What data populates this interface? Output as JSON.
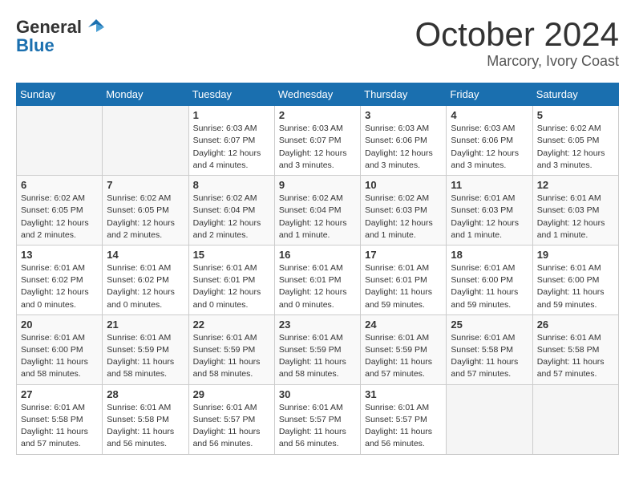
{
  "header": {
    "logo_general": "General",
    "logo_blue": "Blue",
    "month_title": "October 2024",
    "location": "Marcory, Ivory Coast"
  },
  "calendar": {
    "days_of_week": [
      "Sunday",
      "Monday",
      "Tuesday",
      "Wednesday",
      "Thursday",
      "Friday",
      "Saturday"
    ],
    "weeks": [
      [
        {
          "day": "",
          "info": ""
        },
        {
          "day": "",
          "info": ""
        },
        {
          "day": "1",
          "info": "Sunrise: 6:03 AM\nSunset: 6:07 PM\nDaylight: 12 hours and 4 minutes."
        },
        {
          "day": "2",
          "info": "Sunrise: 6:03 AM\nSunset: 6:07 PM\nDaylight: 12 hours and 3 minutes."
        },
        {
          "day": "3",
          "info": "Sunrise: 6:03 AM\nSunset: 6:06 PM\nDaylight: 12 hours and 3 minutes."
        },
        {
          "day": "4",
          "info": "Sunrise: 6:03 AM\nSunset: 6:06 PM\nDaylight: 12 hours and 3 minutes."
        },
        {
          "day": "5",
          "info": "Sunrise: 6:02 AM\nSunset: 6:05 PM\nDaylight: 12 hours and 3 minutes."
        }
      ],
      [
        {
          "day": "6",
          "info": "Sunrise: 6:02 AM\nSunset: 6:05 PM\nDaylight: 12 hours and 2 minutes."
        },
        {
          "day": "7",
          "info": "Sunrise: 6:02 AM\nSunset: 6:05 PM\nDaylight: 12 hours and 2 minutes."
        },
        {
          "day": "8",
          "info": "Sunrise: 6:02 AM\nSunset: 6:04 PM\nDaylight: 12 hours and 2 minutes."
        },
        {
          "day": "9",
          "info": "Sunrise: 6:02 AM\nSunset: 6:04 PM\nDaylight: 12 hours and 1 minute."
        },
        {
          "day": "10",
          "info": "Sunrise: 6:02 AM\nSunset: 6:03 PM\nDaylight: 12 hours and 1 minute."
        },
        {
          "day": "11",
          "info": "Sunrise: 6:01 AM\nSunset: 6:03 PM\nDaylight: 12 hours and 1 minute."
        },
        {
          "day": "12",
          "info": "Sunrise: 6:01 AM\nSunset: 6:03 PM\nDaylight: 12 hours and 1 minute."
        }
      ],
      [
        {
          "day": "13",
          "info": "Sunrise: 6:01 AM\nSunset: 6:02 PM\nDaylight: 12 hours and 0 minutes."
        },
        {
          "day": "14",
          "info": "Sunrise: 6:01 AM\nSunset: 6:02 PM\nDaylight: 12 hours and 0 minutes."
        },
        {
          "day": "15",
          "info": "Sunrise: 6:01 AM\nSunset: 6:01 PM\nDaylight: 12 hours and 0 minutes."
        },
        {
          "day": "16",
          "info": "Sunrise: 6:01 AM\nSunset: 6:01 PM\nDaylight: 12 hours and 0 minutes."
        },
        {
          "day": "17",
          "info": "Sunrise: 6:01 AM\nSunset: 6:01 PM\nDaylight: 11 hours and 59 minutes."
        },
        {
          "day": "18",
          "info": "Sunrise: 6:01 AM\nSunset: 6:00 PM\nDaylight: 11 hours and 59 minutes."
        },
        {
          "day": "19",
          "info": "Sunrise: 6:01 AM\nSunset: 6:00 PM\nDaylight: 11 hours and 59 minutes."
        }
      ],
      [
        {
          "day": "20",
          "info": "Sunrise: 6:01 AM\nSunset: 6:00 PM\nDaylight: 11 hours and 58 minutes."
        },
        {
          "day": "21",
          "info": "Sunrise: 6:01 AM\nSunset: 5:59 PM\nDaylight: 11 hours and 58 minutes."
        },
        {
          "day": "22",
          "info": "Sunrise: 6:01 AM\nSunset: 5:59 PM\nDaylight: 11 hours and 58 minutes."
        },
        {
          "day": "23",
          "info": "Sunrise: 6:01 AM\nSunset: 5:59 PM\nDaylight: 11 hours and 58 minutes."
        },
        {
          "day": "24",
          "info": "Sunrise: 6:01 AM\nSunset: 5:59 PM\nDaylight: 11 hours and 57 minutes."
        },
        {
          "day": "25",
          "info": "Sunrise: 6:01 AM\nSunset: 5:58 PM\nDaylight: 11 hours and 57 minutes."
        },
        {
          "day": "26",
          "info": "Sunrise: 6:01 AM\nSunset: 5:58 PM\nDaylight: 11 hours and 57 minutes."
        }
      ],
      [
        {
          "day": "27",
          "info": "Sunrise: 6:01 AM\nSunset: 5:58 PM\nDaylight: 11 hours and 57 minutes."
        },
        {
          "day": "28",
          "info": "Sunrise: 6:01 AM\nSunset: 5:58 PM\nDaylight: 11 hours and 56 minutes."
        },
        {
          "day": "29",
          "info": "Sunrise: 6:01 AM\nSunset: 5:57 PM\nDaylight: 11 hours and 56 minutes."
        },
        {
          "day": "30",
          "info": "Sunrise: 6:01 AM\nSunset: 5:57 PM\nDaylight: 11 hours and 56 minutes."
        },
        {
          "day": "31",
          "info": "Sunrise: 6:01 AM\nSunset: 5:57 PM\nDaylight: 11 hours and 56 minutes."
        },
        {
          "day": "",
          "info": ""
        },
        {
          "day": "",
          "info": ""
        }
      ]
    ]
  }
}
